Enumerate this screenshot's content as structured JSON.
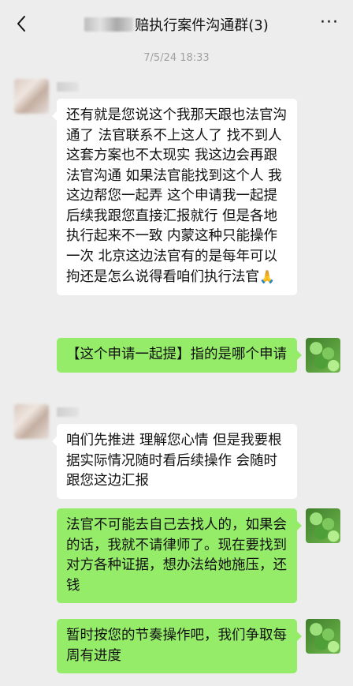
{
  "header": {
    "title": "赔执行案件沟通群(3)",
    "back_icon": "chevron-left-icon",
    "more_label": "···"
  },
  "timestamp": "7/5/24 18:33",
  "messages": [
    {
      "side": "left",
      "text": "还有就是您说这个我那天跟也法官沟通了 法官联系不上这人了 找不到人 这套方案也不太现实 我这边会再跟法官沟通 如果法官能找到这个人 我这边帮您一起弄 这个申请我一起提 后续我跟您直接汇报就行 但是各地执行起来不一致 内蒙这种只能操作一次 北京这边法官有的是每年可以拘还是怎么说得看咱们执行法官",
      "emoji": "🙏"
    },
    {
      "side": "right",
      "text": "【这个申请一起提】指的是哪个申请"
    },
    {
      "side": "left",
      "text": "咱们先推进 理解您心情 但是我要根据实际情况随时看后续操作 会随时跟您这边汇报"
    },
    {
      "side": "right",
      "text": "法官不可能去自己去找人的，如果会的话，我就不请律师了。现在要找到对方各种证据，想办法给她施压，还钱"
    },
    {
      "side": "right",
      "text": "暂时按您的节奏操作吧，我们争取每周有进度"
    }
  ]
}
